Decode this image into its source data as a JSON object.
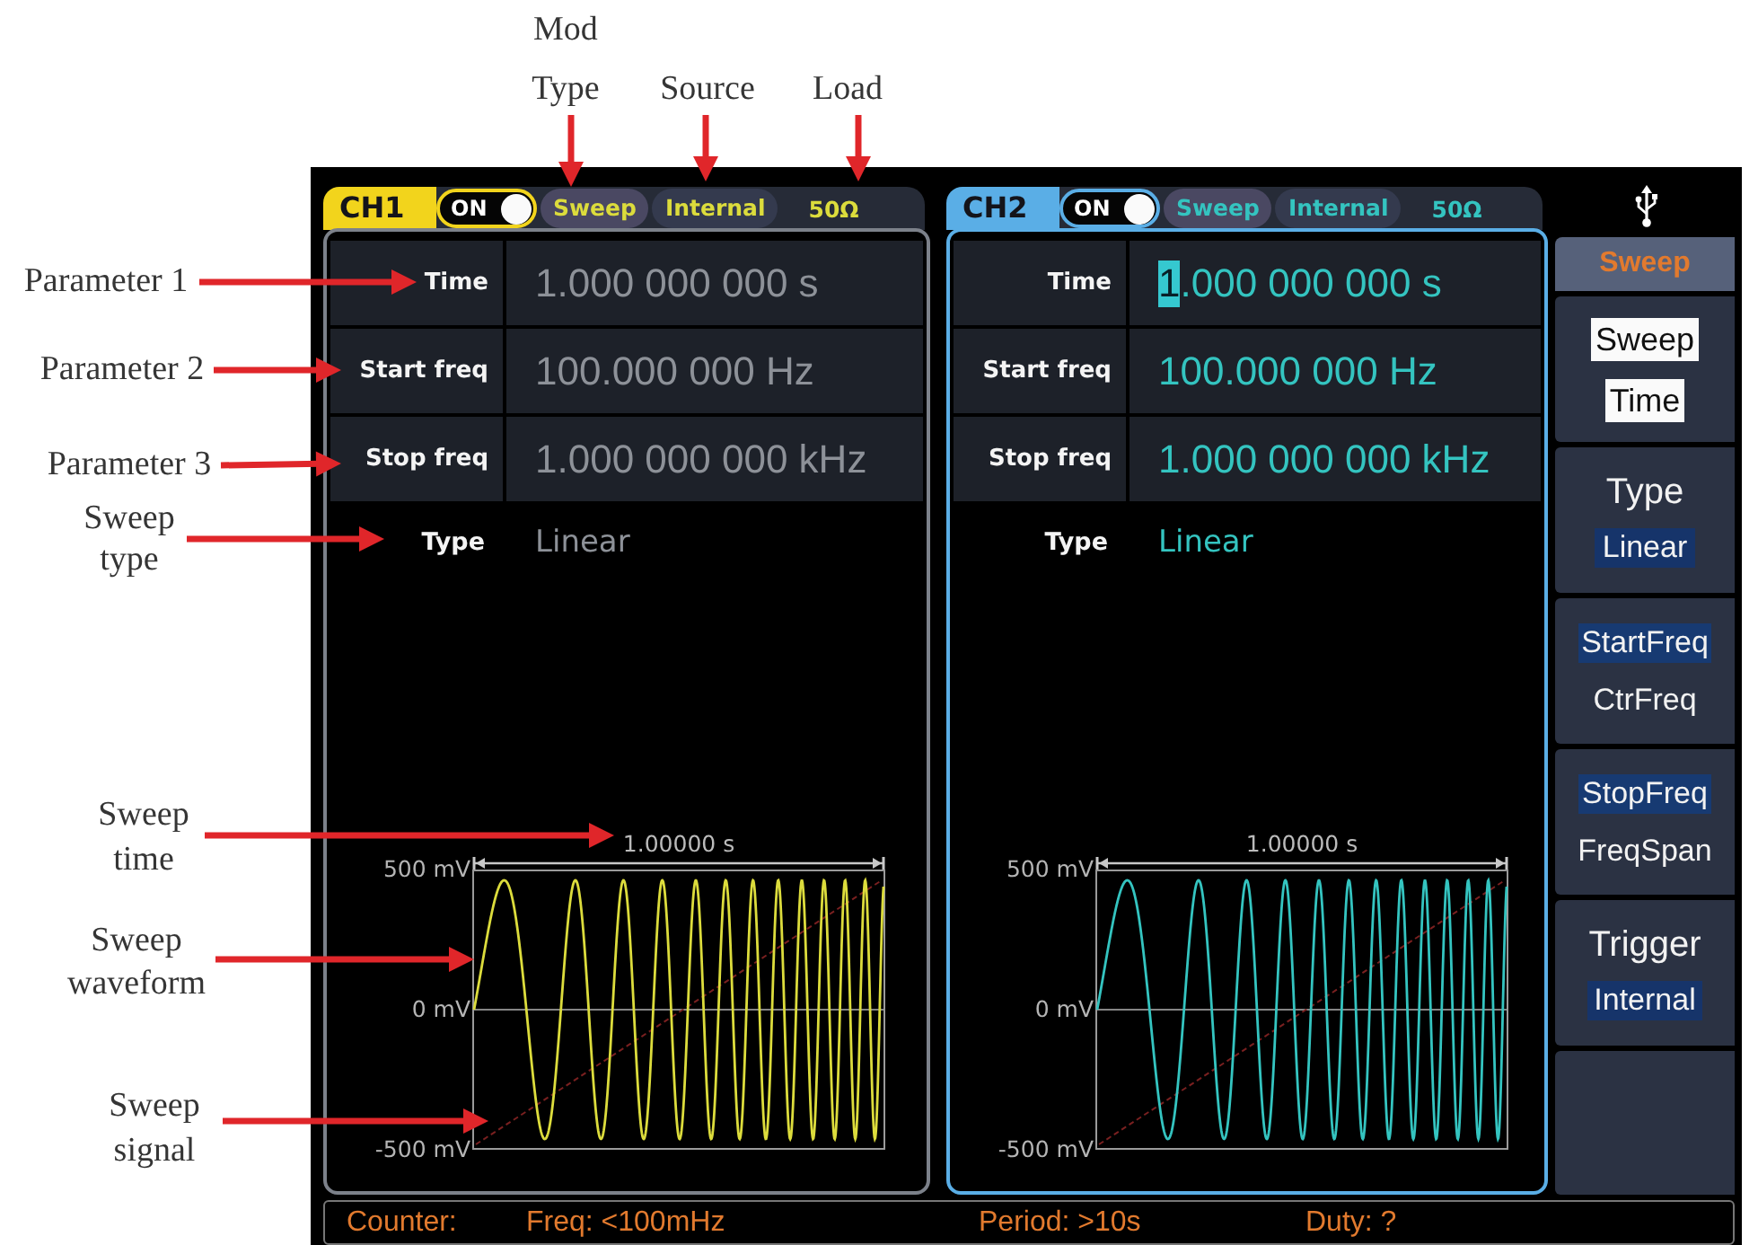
{
  "annotations": {
    "top": [
      {
        "text": "Mod Type"
      },
      {
        "text": "Source"
      },
      {
        "text": "Load"
      }
    ],
    "left": [
      {
        "text": "Parameter 1",
        "kind": "inline"
      },
      {
        "text": "Parameter 2",
        "kind": "inline"
      },
      {
        "text": "Parameter 3",
        "kind": "inline"
      },
      {
        "text": "Sweep type",
        "kind": "stacked"
      },
      {
        "text": "Sweep time",
        "kind": "stacked"
      },
      {
        "text": "Sweep waveform",
        "kind": "stacked"
      },
      {
        "text": "Sweep signal",
        "kind": "stacked"
      }
    ]
  },
  "channels": [
    {
      "name": "CH1",
      "color": "#f2d41c",
      "trace": {
        "color": "#dcdc3c"
      },
      "selected": false,
      "output": {
        "label": "ON",
        "on": true
      },
      "mod_type": "Sweep",
      "source": "Internal",
      "load": "50Ω",
      "params": [
        {
          "label": "Time",
          "value": "1.000 000 000 s",
          "editing": false
        },
        {
          "label": "Start freq",
          "value": "100.000 000 Hz",
          "editing": false
        },
        {
          "label": "Stop freq",
          "value": "1.000 000 000 kHz",
          "editing": false
        }
      ],
      "sweep_type": {
        "label": "Type",
        "value": "Linear"
      },
      "plot": {
        "duration": "1.00000 s",
        "y_labels": [
          "500 mV",
          "0 mV",
          "-500 mV"
        ]
      }
    },
    {
      "name": "CH2",
      "color": "#5aaee6",
      "trace": {
        "color": "#34c4c0"
      },
      "selected": true,
      "output": {
        "label": "ON",
        "on": true
      },
      "mod_type": "Sweep",
      "source": "Internal",
      "load": "50Ω",
      "params": [
        {
          "label": "Time",
          "value": "1.000 000 000 s",
          "editing": true
        },
        {
          "label": "Start freq",
          "value": "100.000 000 Hz",
          "editing": false
        },
        {
          "label": "Stop freq",
          "value": "1.000 000 000 kHz",
          "editing": false
        }
      ],
      "sweep_type": {
        "label": "Type",
        "value": "Linear"
      },
      "plot": {
        "duration": "1.00000 s",
        "y_labels": [
          "500 mV",
          "0 mV",
          "-500 mV"
        ]
      }
    }
  ],
  "menu": {
    "title": "Sweep",
    "items": [
      {
        "kind": "toggle",
        "lines": [
          "Sweep",
          "Time"
        ],
        "active": true
      },
      {
        "kind": "value",
        "title": "Type",
        "value": "Linear"
      },
      {
        "kind": "choice",
        "options": [
          {
            "label": "StartFreq",
            "selected": true
          },
          {
            "label": "CtrFreq",
            "selected": false
          }
        ]
      },
      {
        "kind": "choice",
        "options": [
          {
            "label": "StopFreq",
            "selected": true
          },
          {
            "label": "FreqSpan",
            "selected": false
          }
        ]
      },
      {
        "kind": "value",
        "title": "Trigger",
        "value": "Internal"
      }
    ]
  },
  "counter": {
    "items": [
      "Counter:",
      "Freq: <100mHz",
      "Period: >10s",
      "Duty: ?"
    ]
  }
}
